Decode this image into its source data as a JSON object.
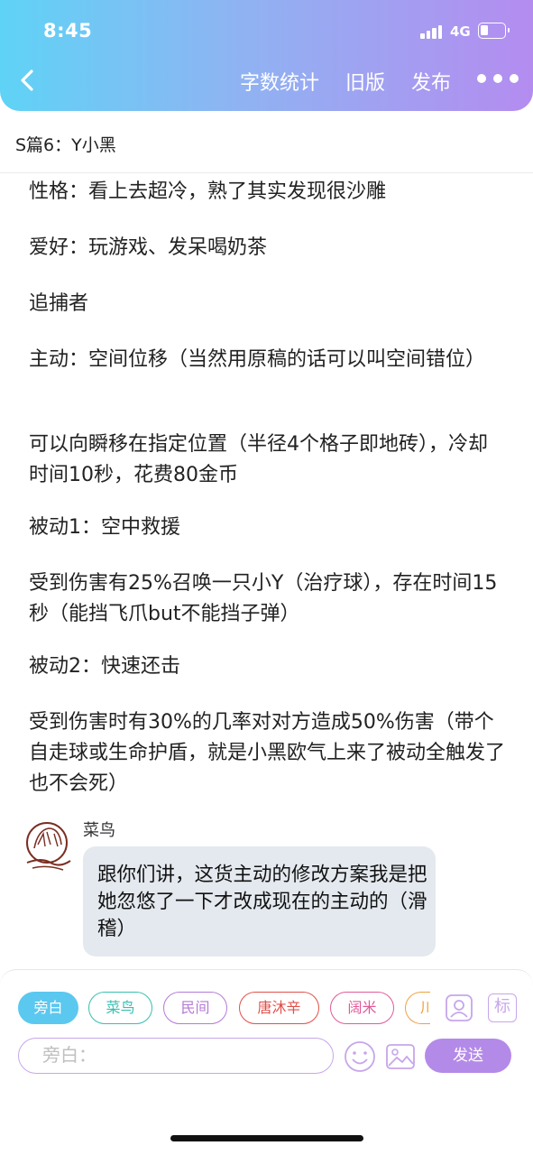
{
  "status_bar": {
    "time": "8:45",
    "network": "4G"
  },
  "nav": {
    "word_count": "字数统计",
    "old_version": "旧版",
    "publish": "发布"
  },
  "chapter_title": "S篇6：Y小黑",
  "paragraphs": [
    "性格：看上去超冷，熟了其实发现很沙雕",
    "爱好：玩游戏、发呆喝奶茶",
    "追捕者",
    "主动：空间位移（当然用原稿的话可以叫空间错位）",
    "可以向瞬移在指定位置（半径4个格子即地砖），冷却时间10秒，花费80金币",
    "被动1：空中救援",
    "受到伤害有25%召唤一只小Y（治疗球），存在时间15秒（能挡飞爪but不能挡子弹）",
    "被动2：快速还击",
    "受到伤害时有30%的几率对对方造成50%伤害（带个自走球或生命护盾，就是小黑欧气上来了被动全触发了也不会死）"
  ],
  "message": {
    "sender": "菜鸟",
    "text": "跟你们讲，这货主动的修改方案我是把她忽悠了一下才改成现在的主动的（滑稽）"
  },
  "characters": [
    {
      "label": "旁白",
      "color": "#5bc8f0"
    },
    {
      "label": "菜鸟",
      "color": "#38bfb1"
    },
    {
      "label": "民间",
      "color": "#b57ad6"
    },
    {
      "label": "唐沐辛",
      "color": "#e0504a"
    },
    {
      "label": "阔米",
      "color": "#e05a9a"
    },
    {
      "label": "川",
      "color": "#f0a040"
    }
  ],
  "input": {
    "placeholder": "旁白："
  },
  "send_label": "发送",
  "tag_label": "标",
  "colors": {
    "accent": "#b48ae8",
    "header_start": "#5fd3f6",
    "header_end": "#b48cf0"
  }
}
